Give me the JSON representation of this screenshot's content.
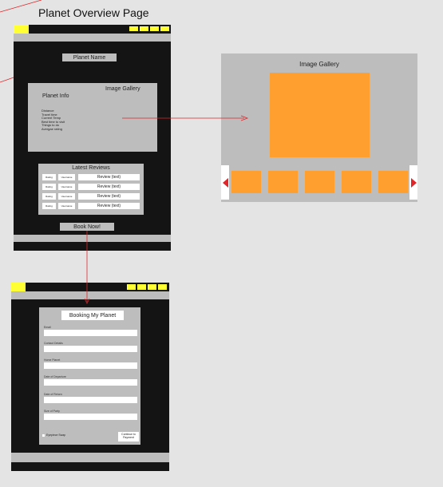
{
  "page_title": "Planet Overview Page",
  "colors": {
    "dark": "#141414",
    "panel_grey": "#bdbdbd",
    "accent_orange": "#ff9f30",
    "nav_yellow": "#ffff33",
    "arrow_red": "#e0262a"
  },
  "overview": {
    "planet_name": "Planet Name",
    "image_gallery_label": "Image Gallery",
    "planet_info_title": "Planet Info",
    "info_items": [
      "Distance",
      "Travel time",
      "Current Temp",
      "Best time to visit",
      "Things to do",
      "Avergae rating"
    ],
    "latest_reviews_title": "Latest Reviews",
    "reviews": [
      {
        "rating": "Rating",
        "username": "Username",
        "review": "Review (text)"
      },
      {
        "rating": "Rating",
        "username": "Username",
        "review": "Review (text)"
      },
      {
        "rating": "Rating",
        "username": "Username",
        "review": "Review (text)"
      },
      {
        "rating": "Rating",
        "username": "Username",
        "review": "Review (text)"
      }
    ],
    "book_button": "Book Now!"
  },
  "gallery": {
    "title": "Image Gallery",
    "prev_icon": "arrow-left-icon",
    "next_icon": "arrow-right-icon"
  },
  "booking": {
    "form_title": "Booking My Planet",
    "fields": [
      "Email",
      "Contact Details",
      "Home Planet",
      "Date of Departure",
      "Date of Return",
      "Size of Party"
    ],
    "checkbox_label": "Eyepiece Swap",
    "continue_button": "Continue to Payment"
  }
}
